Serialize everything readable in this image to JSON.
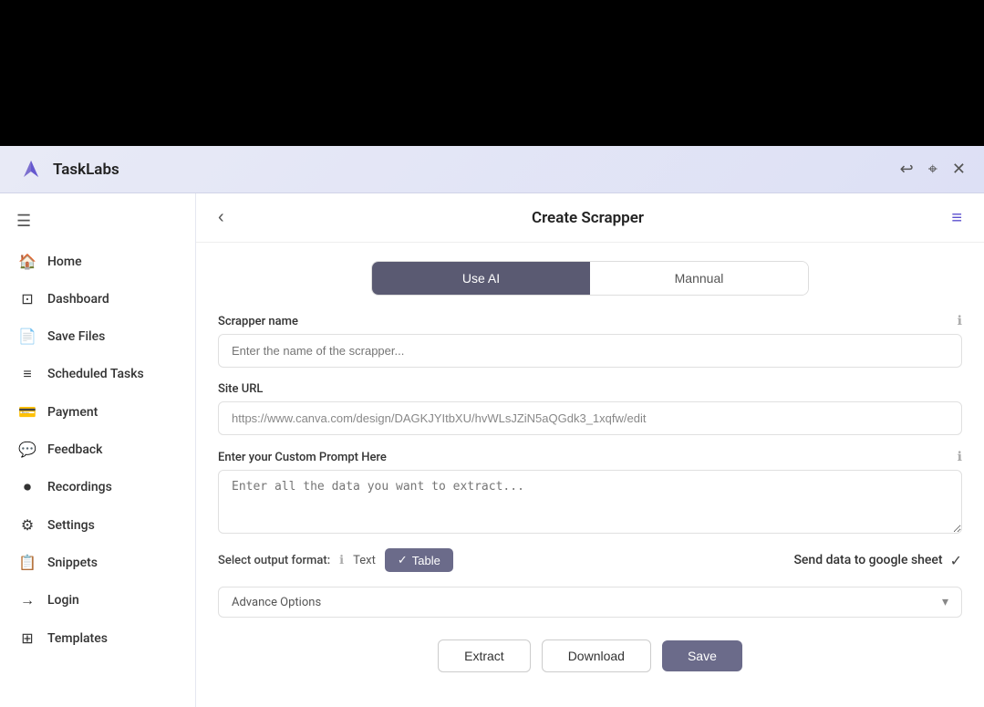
{
  "app": {
    "title": "TaskLabs",
    "logo": "⚡"
  },
  "topbar": {
    "icons": [
      "undo",
      "cursor",
      "close"
    ]
  },
  "sidebar": {
    "hamburger": "☰",
    "items": [
      {
        "id": "home",
        "label": "Home",
        "icon": "⌂"
      },
      {
        "id": "dashboard",
        "label": "Dashboard",
        "icon": "◫"
      },
      {
        "id": "save-files",
        "label": "Save Files",
        "icon": "☰"
      },
      {
        "id": "scheduled-tasks",
        "label": "Scheduled Tasks",
        "icon": "≡"
      },
      {
        "id": "payment",
        "label": "Payment",
        "icon": "▭"
      },
      {
        "id": "feedback",
        "label": "Feedback",
        "icon": "▭"
      },
      {
        "id": "recordings",
        "label": "Recordings",
        "icon": "◎"
      },
      {
        "id": "settings",
        "label": "Settings",
        "icon": "⚙"
      },
      {
        "id": "snippets",
        "label": "Snippets",
        "icon": "📋"
      },
      {
        "id": "login",
        "label": "Login",
        "icon": "→"
      },
      {
        "id": "templates",
        "label": "Templates",
        "icon": "⊞"
      }
    ]
  },
  "content": {
    "header": {
      "back_label": "‹",
      "title": "Create Scrapper",
      "menu_icon": "≡"
    },
    "tabs": [
      {
        "id": "use-ai",
        "label": "Use AI",
        "active": true
      },
      {
        "id": "mannual",
        "label": "Mannual",
        "active": false
      }
    ],
    "form": {
      "scrapper_name": {
        "label": "Scrapper name",
        "placeholder": "Enter the name of the scrapper..."
      },
      "site_url": {
        "label": "Site URL",
        "value": "https://www.canva.com/design/DAGKJYItbXU/hvWLsJZiN5aQGdk3_1xqfw/edit"
      },
      "custom_prompt": {
        "label": "Enter your Custom Prompt Here",
        "placeholder": "Enter all the data you want to extract..."
      },
      "output_format": {
        "label": "Select output format:",
        "text_option": "Text",
        "table_option": "Table",
        "table_active": true
      },
      "google_sheet": {
        "label": "Send data to google sheet",
        "checked": true
      },
      "advance_options": {
        "label": "Advance Options"
      },
      "buttons": {
        "extract": "Extract",
        "download": "Download",
        "save": "Save"
      }
    }
  }
}
